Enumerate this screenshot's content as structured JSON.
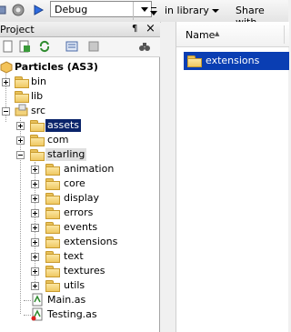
{
  "toolbar": {
    "build_config": "Debug",
    "icons": [
      "settings-gear-icon",
      "run-arrow-icon",
      "dropdown-arrow-icon"
    ]
  },
  "project_panel": {
    "title": "Project",
    "pin_icon": "¶",
    "close_icon": "×",
    "tree": {
      "root": "Particles (AS3)",
      "bin": "bin",
      "lib": "lib",
      "src": "src",
      "assets": "assets",
      "com": "com",
      "starling": "starling",
      "starling_children": [
        "animation",
        "core",
        "display",
        "errors",
        "events",
        "extensions",
        "text",
        "textures",
        "utils"
      ],
      "files": [
        "Main.as",
        "Testing.as"
      ]
    }
  },
  "library": {
    "in_library": "in library",
    "share_with": "Share with",
    "column_name": "Name",
    "items": [
      "extensions"
    ]
  },
  "colors": {
    "selection": "#0a246a",
    "library_selection": "#0a3eb3",
    "folder": "#efc862"
  }
}
